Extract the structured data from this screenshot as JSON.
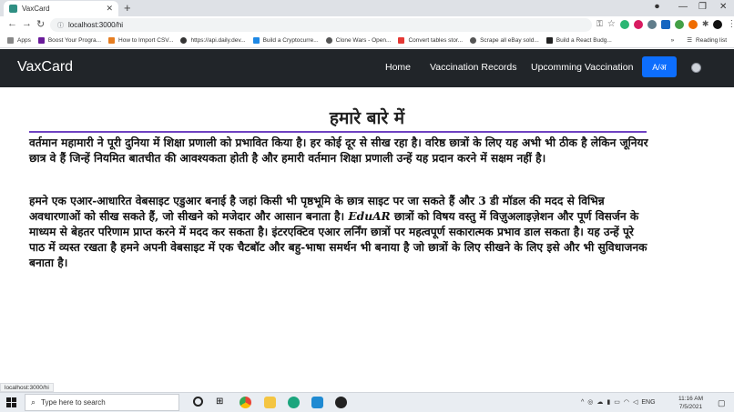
{
  "browser": {
    "tab_title": "VaxCard",
    "new_tab_glyph": "+",
    "tab_close_glyph": "✕",
    "url": "localhost:3000/hi",
    "bookmarks": [
      {
        "label": "Apps",
        "color": "#4285f4"
      },
      {
        "label": "Boost Your Progra...",
        "color": "#6a1b9a"
      },
      {
        "label": "How to Import CSV...",
        "color": "#e67e22"
      },
      {
        "label": "https://api.daily.dev...",
        "color": "#333333"
      },
      {
        "label": "Build a Cryptocurre...",
        "color": "#1e88e5"
      },
      {
        "label": "Clone Wars - Open...",
        "color": "#555555"
      },
      {
        "label": "Convert tables stor...",
        "color": "#e53935"
      },
      {
        "label": "Scrape all eBay sold...",
        "color": "#555555"
      },
      {
        "label": "Build a React Budg...",
        "color": "#222222"
      }
    ],
    "bookmarks_more": "»",
    "reading_list": "Reading list"
  },
  "app": {
    "brand": "VaxCard",
    "nav": {
      "home": "Home",
      "records": "Vaccination Records",
      "upcoming": "Upcomming Vaccination",
      "lang_button": "A/अ"
    },
    "accent": "#0d6efd",
    "rule_color": "#6f42c1"
  },
  "main": {
    "heading": "हमारे बारे में",
    "paragraph1": "वर्तमान महामारी ने पूरी दुनिया में शिक्षा प्रणाली को प्रभावित किया है। हर कोई दूर से सीख रहा है। वरिष्ठ छात्रों के लिए यह अभी भी ठीक है लेकिन जूनियर छात्र वे हैं जिन्हें नियमित बातचीत की आवश्यकता होती है और हमारी वर्तमान शिक्षा प्रणाली उन्हें यह प्रदान करने में सक्षम नहीं है।",
    "paragraph2_a": "हमने एक एआर-आधारित वेबसाइट एडुआर बनाई है जहां किसी भी पृष्ठभूमि के छात्र साइट पर जा सकते हैं और 3 डी मॉडल की मदद से विभिन्न अवधारणाओं को सीख सकते हैं, जो सीखने को मजेदार और आसान बनाता है। ",
    "paragraph2_brand": "EduAR",
    "paragraph2_b": " छात्रों को विषय वस्तु में विज़ुअलाइज़ेशन और पूर्ण विसर्जन के माध्यम से बेहतर परिणाम प्राप्त करने में मदद कर सकता है। इंटरएक्टिव एआर लर्निंग छात्रों पर महत्वपूर्ण सकारात्मक प्रभाव डाल सकता है। यह उन्हें पूरे पाठ में व्यस्त रखता है हमने अपनी वेबसाइट में एक चैटबॉट और बहु-भाषा समर्थन भी बनाया है जो छात्रों के लिए सीखने के लिए इसे और भी सुविधाजनक बनाता है।"
  },
  "status_url": "localhost:3000/hi",
  "taskbar": {
    "search_placeholder": "Type here to search",
    "lang": "ENG",
    "time": "11:16 AM",
    "date": "7/5/2021"
  }
}
